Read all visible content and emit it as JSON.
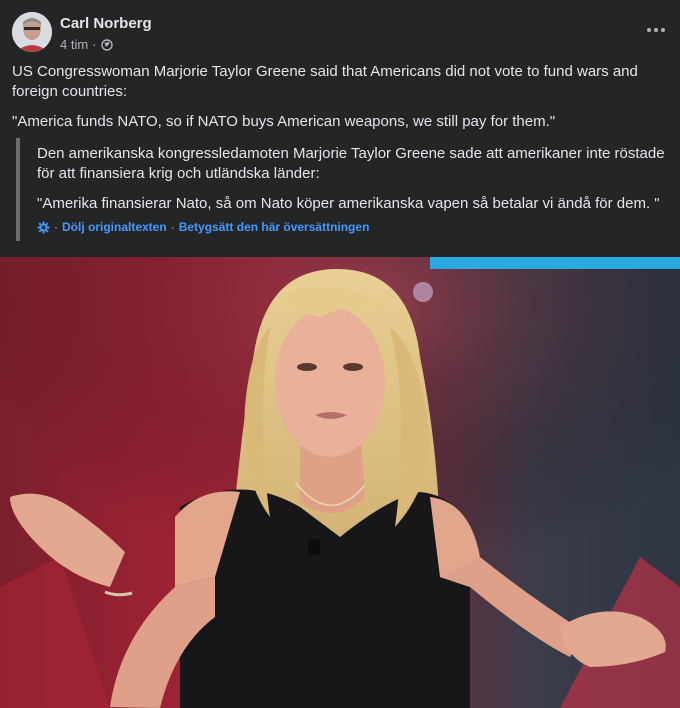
{
  "post": {
    "author": "Carl Norberg",
    "time": "4 tim",
    "dot": "·",
    "original_text": [
      "US Congresswoman Marjorie Taylor Greene said that Americans did not vote to fund wars and foreign countries:",
      "\"America funds NATO, so if NATO buys American weapons, we still pay for them.\""
    ],
    "translation": [
      "Den amerikanska kongressledamoten Marjorie Taylor Greene sade att amerikaner inte röstade för att finansiera krig och utländska länder:",
      "\"Amerika finansierar Nato, så om Nato köper amerikanska vapen så betalar vi ändå för dem. \""
    ],
    "translation_links": {
      "hide": "Dölj originaltexten",
      "separator": "·",
      "rate": "Betygsätt den här översättningen"
    }
  },
  "colors": {
    "background": "#242526",
    "text": "#e4e6eb",
    "secondary": "#b0b3b8",
    "link": "#4599ff"
  },
  "icons": [
    "globe-icon",
    "more-options-icon",
    "gear-icon"
  ]
}
